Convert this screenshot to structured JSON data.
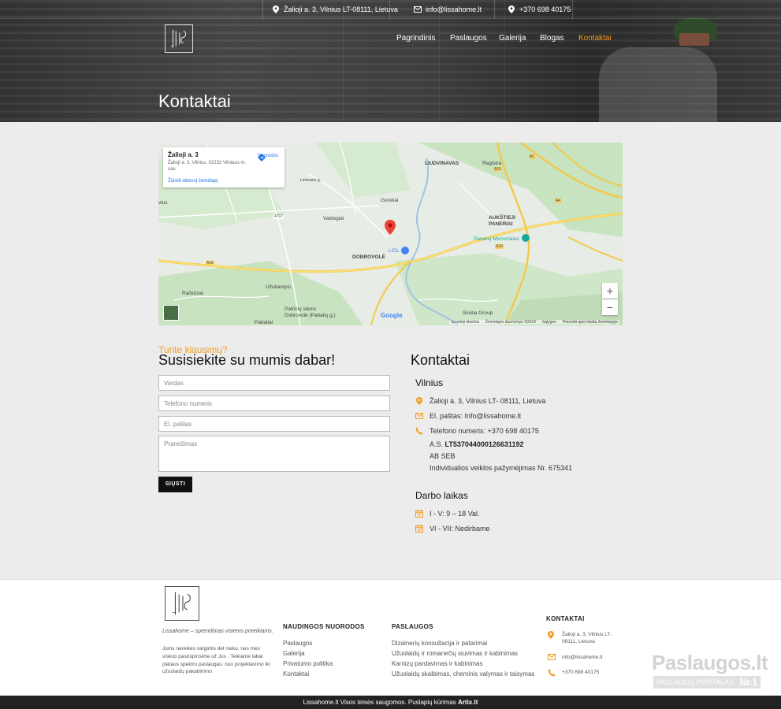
{
  "topbar": {
    "address": "Žalioji a. 3, Vilnius LT-08111, Lietuva",
    "email": "info@lissahome.lt",
    "phone": "+370 698 40175"
  },
  "nav": {
    "items": [
      "Pagrindinis",
      "Paslaugos",
      "Galerija",
      "Blogas",
      "Kontaktai"
    ],
    "active": "Kontaktai"
  },
  "hero": {
    "title": "Kontaktai"
  },
  "map": {
    "card_title": "Žalioji a. 3",
    "card_address": "Žalioji a. 3, Vilnius, 02232 Vilniaus m. sav.",
    "card_link": "Žiūrėti didesnį žemėlapį",
    "directions": "Nuorodos",
    "zoom_in": "+",
    "zoom_out": "−",
    "labels": {
      "liudvinavas": "LIUDVINAVAS",
      "registra": "Registra",
      "gureliai": "Gureliai",
      "vaidegiai": "Vaidegiai",
      "aukstieji": "AUKŠTIEJI",
      "paneriai": "PANERIAI",
      "memorialas": "Panerių Memorialas",
      "dobrovole": "DOBROVOLĖ",
      "lidl": "LIDL",
      "uzukampis": "Užukampis",
      "rackunai": "Račkūnai",
      "patriciu": "Patričių slėnis",
      "dobrovole2": "Dobrovolė (Pabalių g.)",
      "pabaliai": "Pabaliai",
      "skuba": "Skuba Group",
      "vius": "vius",
      "lentvario": "Lentvario g.",
      "a16": "A16",
      "a4": "A4",
      "a1": "A1",
      "a15": "A15",
      "a19": "A19",
      "a4707": "4707"
    },
    "google": "Google",
    "footer": [
      "Spartieji klavišai",
      "Žemėlapio duomenys ©2024",
      "Sąlygos",
      "Pranešti apie klaidą žemėlapyje"
    ]
  },
  "form": {
    "question": "Turite klausimų?",
    "title": "Susisiekite su mumis dabar!",
    "name_placeholder": "Vardas",
    "phone_placeholder": "Telefono numeris",
    "email_placeholder": "El. paštas",
    "message_placeholder": "Pranešimas",
    "submit": "SIŲSTI"
  },
  "contacts": {
    "title": "Kontaktai",
    "city": "Vilnius",
    "address": "Žalioji a. 3, Vilnius LT- 08111, Lietuva",
    "email": "El. paštas: Info@lissahome.lt",
    "phone": "Telefono numeris: +370 698 40175",
    "account_prefix": "A.S.",
    "account": "LT537044000126631192",
    "bank": "AB SEB",
    "license": "Individualios veiklos pažymėjimas Nr. 675341",
    "hours_title": "Darbo laikas",
    "hours_weekdays": "I - V: 9 – 18 Val.",
    "hours_weekend": "VI - VII: Nedirbame"
  },
  "footer": {
    "tagline": "Lissahome – sprendimas visiems poreikiams.",
    "description": "Jums nereikės vargintis dėl nieko, nes mes viskuo pasirūpinsime už Jus . Teikiame labai plataus spektro paslaugas: nuo projektavimo iki užuolaidų pakabinimo",
    "useful_title": "NAUDINGOS NUORODOS",
    "useful_links": [
      "Paslaugos",
      "Galerija",
      "Privatumo politika",
      "Kontaktai"
    ],
    "services_title": "PASLAUGOS",
    "services": [
      "Dizainerių konsultacija ir patarimai",
      "Užuolaidų ir romanečių siuvimas ir kabinimas",
      "Karnizų pardavimas ir kabinimas",
      "Užuolaidų skalbimas, cheminis valymas ir taisymas"
    ],
    "contacts_title": "KONTAKTAI",
    "address_line1": "Žalioji a. 3, Vilnius LT-",
    "address_line2": "08111, Lietuva",
    "email": "info@lissahome.lt",
    "phone": "+370 698 40175",
    "badge_big": "Paslaugos.lt",
    "badge_small": "PASLAUGŲ PORTALAS",
    "badge_nr": "Nr.1"
  },
  "bottom": {
    "text": "Lissahome.lt Visos teisės saugomos. Puslapių kūrimas",
    "brand": "Artix.lt"
  },
  "colors": {
    "accent": "#f39c1f",
    "dark": "#111111"
  },
  "icons": [
    "location-pin-icon",
    "envelope-icon",
    "phone-icon",
    "calendar-icon",
    "plus-icon",
    "minus-icon",
    "directions-icon"
  ]
}
